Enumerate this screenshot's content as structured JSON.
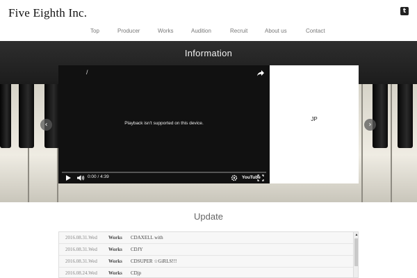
{
  "header": {
    "logo": "Five Eighth Inc.",
    "twitter_glyph": "t"
  },
  "nav": {
    "items": [
      {
        "label": "Top"
      },
      {
        "label": "Producer"
      },
      {
        "label": "Works"
      },
      {
        "label": "Audition"
      },
      {
        "label": "Recruit"
      },
      {
        "label": "About us"
      },
      {
        "label": "Contact"
      }
    ]
  },
  "hero": {
    "title": "Information",
    "prev_glyph": "‹",
    "next_glyph": "›"
  },
  "video": {
    "title_slash": "/",
    "message": "Playback isn't supported on this device.",
    "time": "0:00 / 4:39",
    "youtube_label": "YouTube",
    "progress": 0
  },
  "panel": {
    "text": "JP"
  },
  "update": {
    "title": "Update",
    "rows": [
      {
        "date": "2016.08.31.Wed",
        "category": "Works",
        "title": "CDAXELL with"
      },
      {
        "date": "2016.08.31.Wed",
        "category": "Works",
        "title": "CDJY"
      },
      {
        "date": "2016.08.31.Wed",
        "category": "Works",
        "title": "CDSUPER ☆GiRLS!!!"
      },
      {
        "date": "2016.08.24.Wed",
        "category": "Works",
        "title": "CDjp"
      }
    ]
  },
  "colors": {
    "hero_dark": "#1c1c1c",
    "update_bg": "#f7f7f7"
  }
}
